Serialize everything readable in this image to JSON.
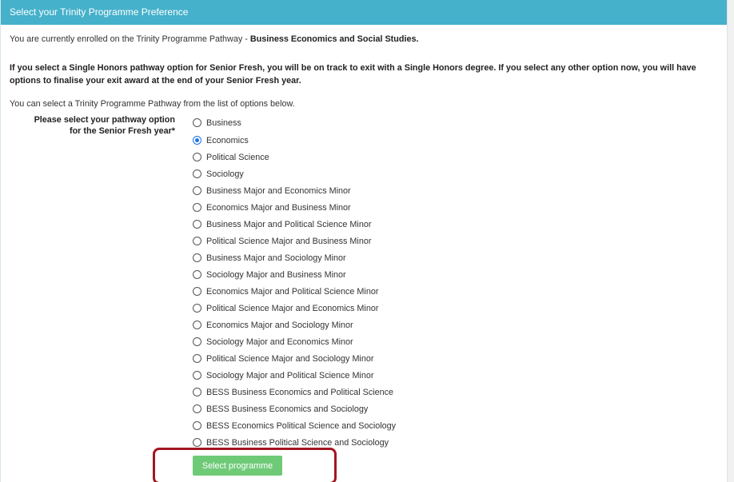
{
  "header": {
    "title": "Select your Trinity Programme Preference"
  },
  "intro": {
    "prefix": "You are currently enrolled on the Trinity Programme Pathway - ",
    "pathway": "Business Economics and Social Studies."
  },
  "note": "If you select a Single Honors pathway option for Senior Fresh, you will be on track to exit with a Single Honors degree. If you select any other option now, you will have options to finalise your exit award at the end of your Senior Fresh year.",
  "hint": "You can select a Trinity Programme Pathway from the list of options below.",
  "field": {
    "label": "Please select your pathway option for the Senior Fresh year*",
    "selected": "Economics",
    "options": [
      "Business",
      "Economics",
      "Political Science",
      "Sociology",
      "Business Major and Economics Minor",
      "Economics Major and Business Minor",
      "Business Major and Political Science Minor",
      "Political Science Major and Business Minor",
      "Business Major and Sociology Minor",
      "Sociology Major and Business Minor",
      "Economics Major and Political Science Minor",
      "Political Science Major and Economics Minor",
      "Economics Major and Sociology Minor",
      "Sociology Major and Economics Minor",
      "Political Science Major and Sociology Minor",
      "Sociology Major and Political Science Minor",
      "BESS Business Economics and Political Science",
      "BESS Business Economics and Sociology",
      "BESS Economics Political Science and Sociology",
      "BESS Business Political Science and Sociology"
    ]
  },
  "submit": {
    "label": "Select programme"
  },
  "colors": {
    "header": "#46b1cb",
    "button": "#6fca78",
    "highlight": "#a31621",
    "radio_selected": "#1a73e8"
  }
}
